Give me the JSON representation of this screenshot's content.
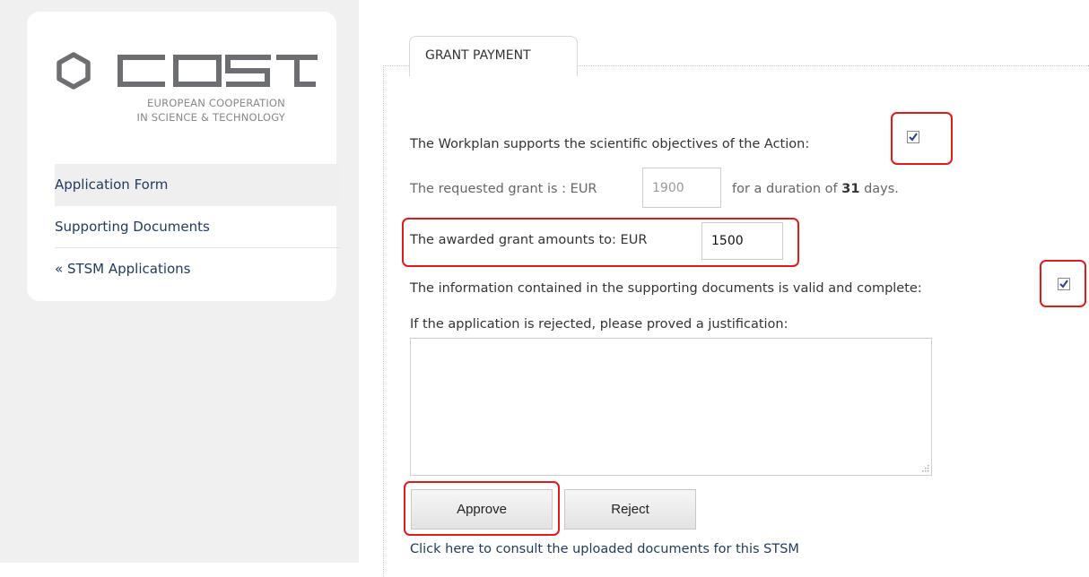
{
  "brand": {
    "name": "cost",
    "subtitle_line1": "EUROPEAN COOPERATION",
    "subtitle_line2": "IN SCIENCE & TECHNOLOGY",
    "colors": {
      "logo_gray": "#6d6e71"
    }
  },
  "sidebar": {
    "items": [
      {
        "label": "Application Form",
        "active": true
      },
      {
        "label": "Supporting Documents",
        "active": false
      },
      {
        "label": "« STSM Applications",
        "active": false
      }
    ]
  },
  "main": {
    "tab_label": "GRANT PAYMENT",
    "workplan_text": "The Workplan supports the scientific objectives of the Action:",
    "workplan_checked": true,
    "requested_prefix": "The requested grant is : EUR",
    "requested_value": "1900",
    "duration_prefix": "for a duration of",
    "duration_days": "31",
    "duration_suffix": "days.",
    "awarded_label": "The awarded grant amounts to: EUR",
    "awarded_value": "1500",
    "documents_text": "The information contained in the supporting documents is valid and complete:",
    "documents_checked": true,
    "justification_label": "If the application is rejected, please proved a justification:",
    "justification_value": "",
    "approve_label": "Approve",
    "reject_label": "Reject",
    "consult_link": "Click here to consult the uploaded documents for this STSM"
  },
  "colors": {
    "highlight": "#e11a1a",
    "link": "#1f3a5f",
    "sidebar_bg": "#f0f0f0"
  }
}
